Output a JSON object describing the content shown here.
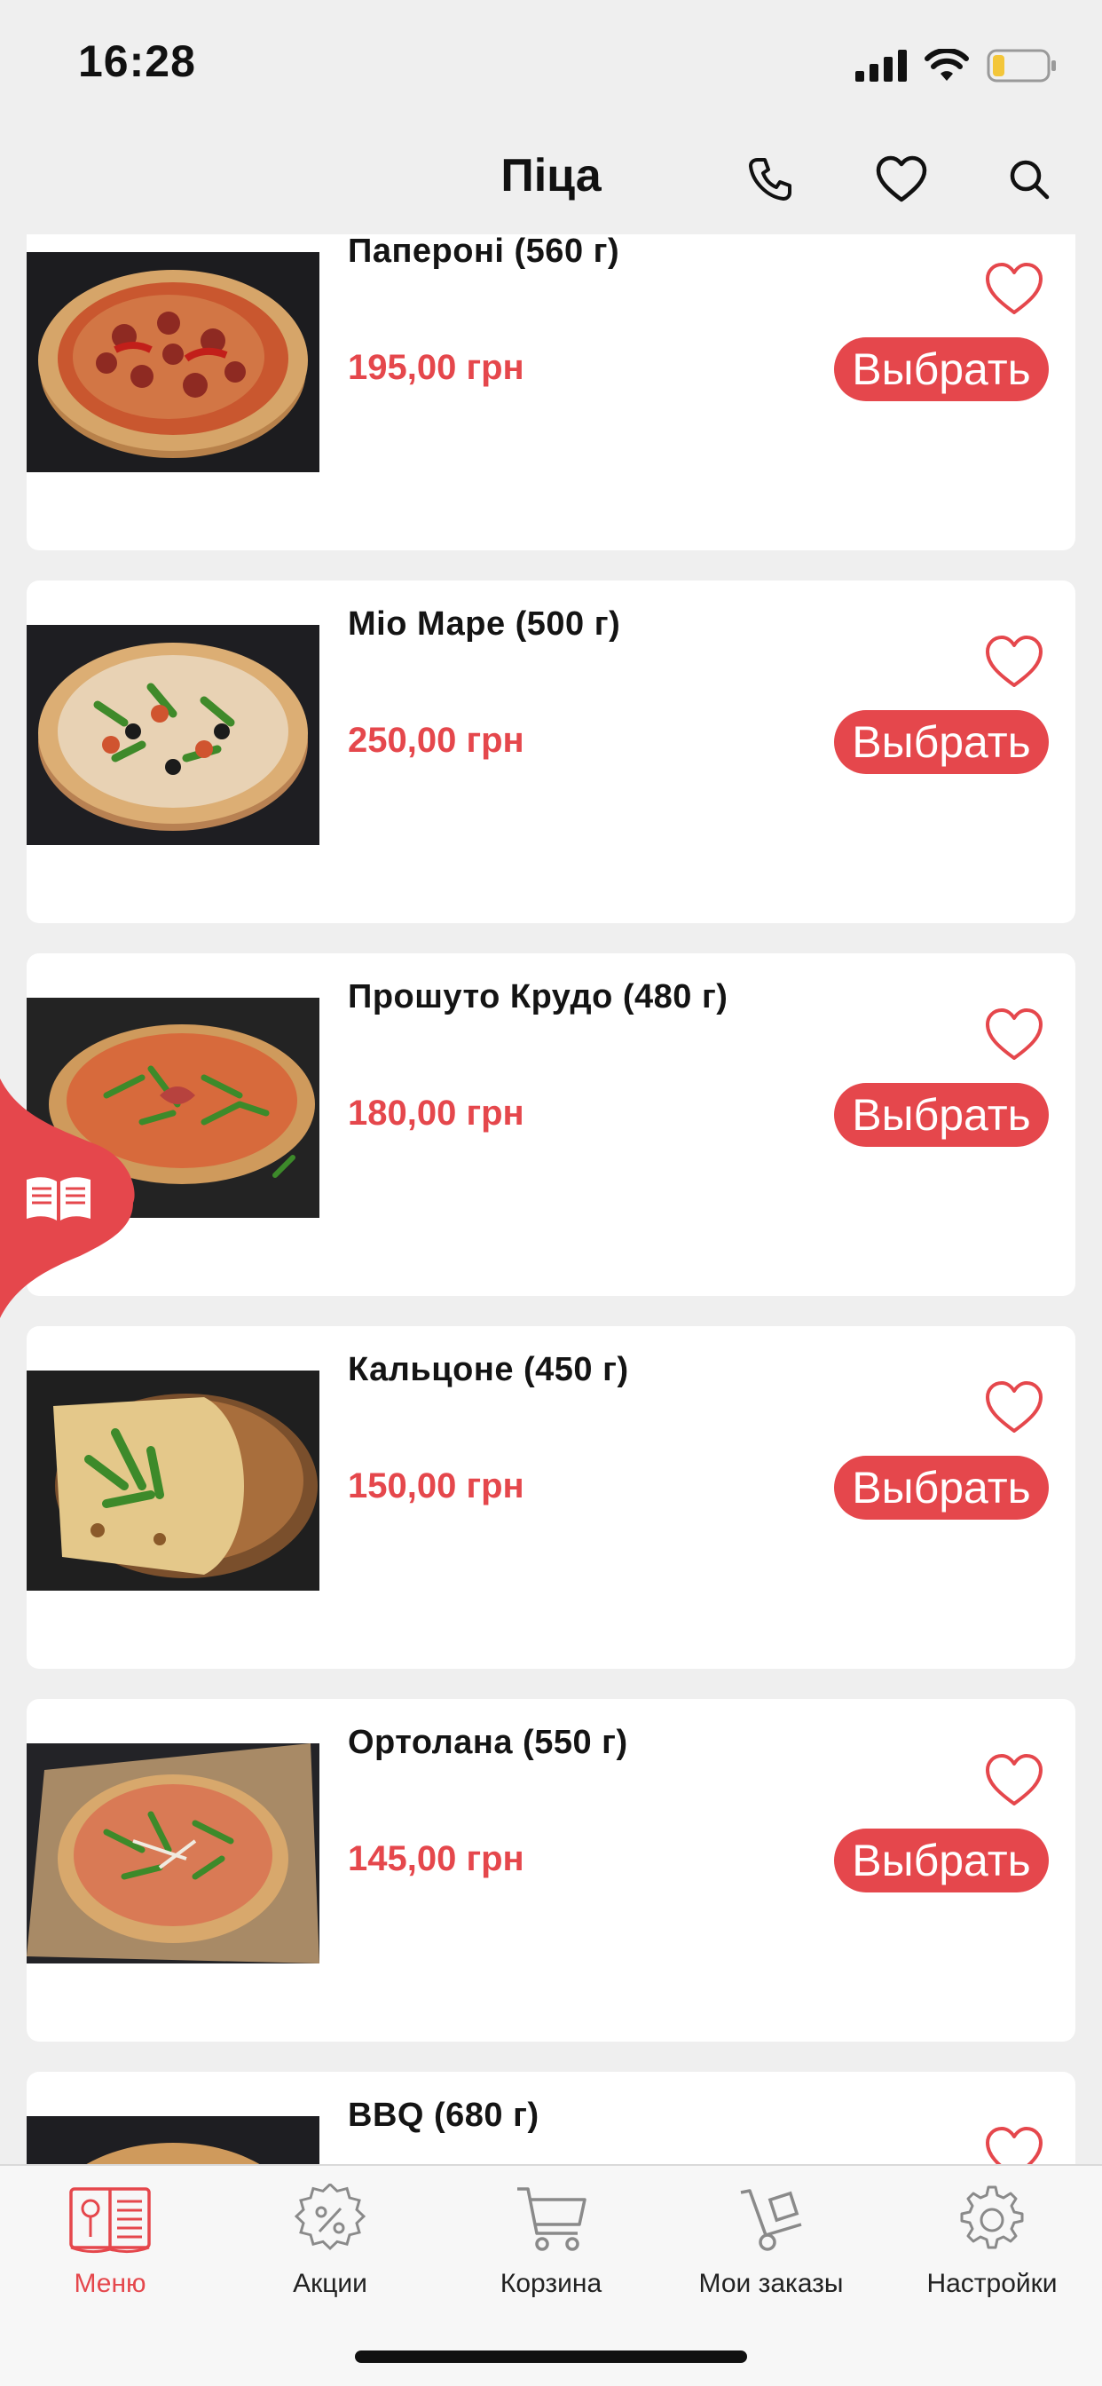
{
  "status_bar": {
    "time": "16:28"
  },
  "header": {
    "title": "Піца",
    "icons": [
      "phone-icon",
      "heart-icon",
      "search-icon"
    ]
  },
  "colors": {
    "accent": "#e5474c",
    "background": "#efefef",
    "card": "#ffffff"
  },
  "products": [
    {
      "title": "Папероні (560 г)",
      "price": "195,00 грн",
      "button": "Выбрать",
      "image": "pizza-pepperoni"
    },
    {
      "title": "Міо Маре (500 г)",
      "price": "250,00 грн",
      "button": "Выбрать",
      "image": "pizza-seafood"
    },
    {
      "title": "Прошуто Крудо (480 г)",
      "price": "180,00 грн",
      "button": "Выбрать",
      "image": "pizza-prosciutto"
    },
    {
      "title": "Кальцоне (450 г)",
      "price": "150,00 грн",
      "button": "Выбрать",
      "image": "pizza-calzone"
    },
    {
      "title": "Ортолана (550 г)",
      "price": "145,00 грн",
      "button": "Выбрать",
      "image": "pizza-ortolana"
    },
    {
      "title": "BBQ (680 г)",
      "price": "",
      "button": "",
      "image": "pizza-bbq"
    }
  ],
  "tab_bar": {
    "items": [
      {
        "label": "Меню",
        "icon": "menu-book-icon",
        "active": true
      },
      {
        "label": "Акции",
        "icon": "discount-gear-icon",
        "active": false
      },
      {
        "label": "Корзина",
        "icon": "cart-icon",
        "active": false
      },
      {
        "label": "Мои заказы",
        "icon": "hand-truck-icon",
        "active": false
      },
      {
        "label": "Настройки",
        "icon": "settings-icon",
        "active": false
      }
    ]
  }
}
